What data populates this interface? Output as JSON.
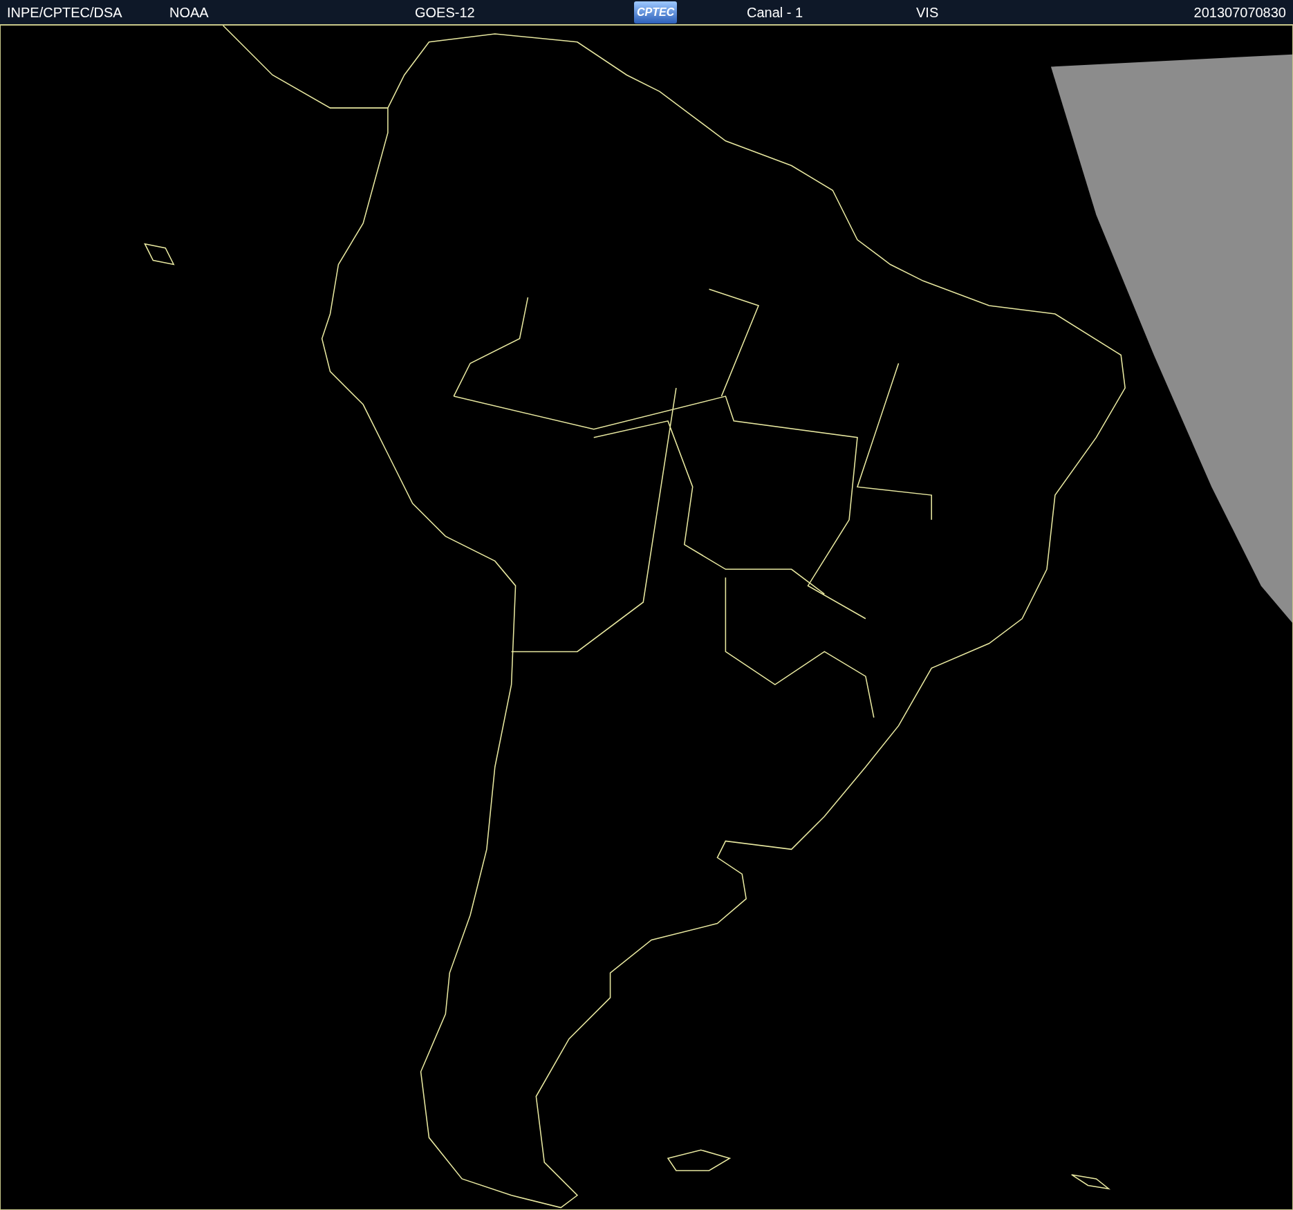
{
  "header": {
    "items": [
      {
        "kind": "text",
        "text": "INPE/CPTEC/DSA"
      },
      {
        "kind": "text",
        "text": "NOAA"
      },
      {
        "kind": "text",
        "text": "GOES-12"
      },
      {
        "kind": "logo",
        "text": "CPTEC"
      },
      {
        "kind": "text",
        "text": "Canal - 1"
      },
      {
        "kind": "text",
        "text": "VIS"
      },
      {
        "kind": "text",
        "text": "201307070830"
      }
    ]
  }
}
